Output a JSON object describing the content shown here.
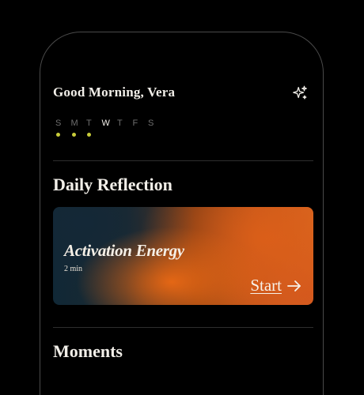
{
  "header": {
    "greeting": "Good Morning, Vera",
    "action_icon": "sparkle-icon"
  },
  "week": {
    "days": [
      {
        "letter": "S",
        "completed": true,
        "today": false
      },
      {
        "letter": "M",
        "completed": true,
        "today": false
      },
      {
        "letter": "T",
        "completed": true,
        "today": false
      },
      {
        "letter": "W",
        "completed": false,
        "today": true
      },
      {
        "letter": "T",
        "completed": false,
        "today": false
      },
      {
        "letter": "F",
        "completed": false,
        "today": false
      },
      {
        "letter": "S",
        "completed": false,
        "today": false
      }
    ],
    "dot_color": "#c8cc3a"
  },
  "daily_reflection": {
    "section_title": "Daily Reflection",
    "card": {
      "title": "Activation Energy",
      "duration": "2 min",
      "start_label": "Start",
      "start_icon": "arrow-right-icon"
    }
  },
  "moments": {
    "section_title": "Moments"
  }
}
